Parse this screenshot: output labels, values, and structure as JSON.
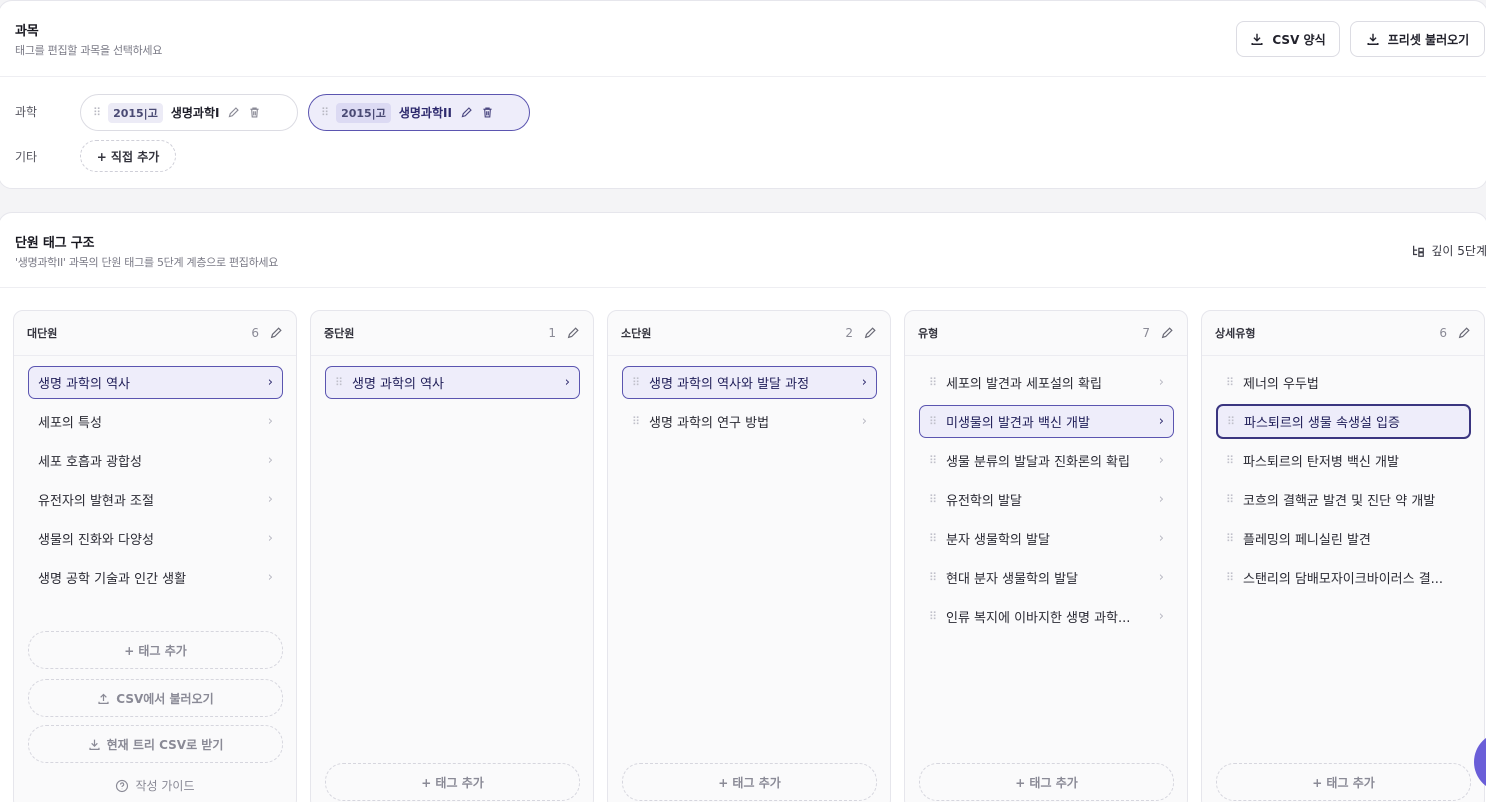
{
  "subjects": {
    "title": "과목",
    "subtitle": "태그를 편집할 과목을 선택하세요",
    "csv_button": "CSV 양식",
    "preset_button": "프리셋 불러오기",
    "science_label": "과학",
    "other_label": "기타",
    "chips": [
      {
        "year": "2015|고",
        "name": "생명과학I"
      },
      {
        "year": "2015|고",
        "name": "생명과학II"
      }
    ],
    "add_direct": "+ 직접 추가"
  },
  "tags": {
    "title": "단원 태그 구조",
    "subtitle": "'생명과학II' 과목의 단원 태그를 5단계 계층으로 편집하세요",
    "depth": "깊이 5단계",
    "add_tag": "+ 태그 추가",
    "csv_import": "CSV에서 불러오기",
    "csv_export": "현재 트리 CSV로 받기",
    "guide": "작성 가이드",
    "columns": [
      {
        "title": "대단원",
        "count": "6",
        "items": [
          "생명 과학의 역사",
          "세포의 특성",
          "세포 호흡과 광합성",
          "유전자의 발현과 조절",
          "생물의 진화와 다양성",
          "생명 공학 기술과 인간 생활"
        ]
      },
      {
        "title": "중단원",
        "count": "1",
        "items": [
          "생명 과학의 역사"
        ]
      },
      {
        "title": "소단원",
        "count": "2",
        "items": [
          "생명 과학의 역사와 발달 과정",
          "생명 과학의 연구 방법"
        ]
      },
      {
        "title": "유형",
        "count": "7",
        "items": [
          "세포의 발견과 세포설의 확립",
          "미생물의 발견과 백신 개발",
          "생물 분류의 발달과 진화론의 확립",
          "유전학의 발달",
          "분자 생물학의 발달",
          "현대 분자 생물학의 발달",
          "인류 복지에 이바지한 생명 과학..."
        ]
      },
      {
        "title": "상세유형",
        "count": "6",
        "items": [
          "제너의 우두법",
          "파스퇴르의 생물 속생설 입증",
          "파스퇴르의 탄저병 백신 개발",
          "코흐의 결핵균 발견 및 진단 약 개발",
          "플레밍의 페니실린 발견",
          "스탠리의 담배모자이크바이러스 결..."
        ]
      }
    ]
  },
  "colors": {
    "accent": "#5b55b0",
    "accent_bg": "#eeedfa",
    "fab": "#6a5ed8"
  }
}
